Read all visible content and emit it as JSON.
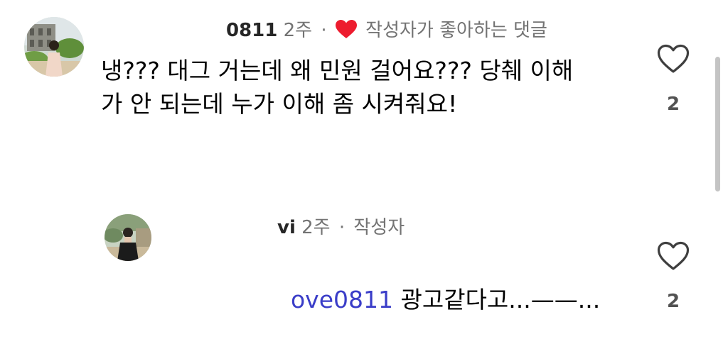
{
  "comment": {
    "username": "0811",
    "time": "2주",
    "separator": "·",
    "author_liked_label": "작성자가 좋아하는 댓글",
    "text": "냉??? 대그 거는데 왜 민원 걸어요??? 당췌 이해\n가 안 되는데 누가 이해 좀 시켜줘요!",
    "like_count": "2",
    "like_icon": "heart-outline-icon"
  },
  "reply": {
    "username": "vi",
    "time": "2주",
    "separator": "·",
    "author_badge": "작성자",
    "mention": "ove0811",
    "text": " 광고같다고...——...",
    "like_count": "2",
    "like_icon": "heart-outline-icon"
  },
  "colors": {
    "heart_red": "#ed1c2e",
    "mention_blue": "#3a3dc8",
    "meta_gray": "#737373"
  }
}
